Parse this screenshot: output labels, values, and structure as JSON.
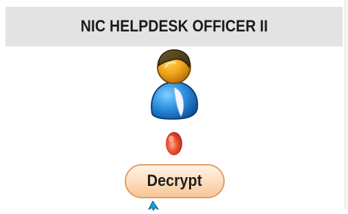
{
  "header": {
    "title": "NIC HELPDESK OFFICER II"
  },
  "avatar": {
    "icon": "user-avatar-icon"
  },
  "status": {
    "icon": "red-status-dot-icon",
    "color": "#e8412a"
  },
  "actions": {
    "decrypt_label": "Decrypt"
  },
  "cursor": {
    "icon": "arrow-cursor-icon",
    "color": "#1e9fd6"
  },
  "colors": {
    "header_bg": "#e3e3e3",
    "button_border": "#e29c5f",
    "button_fill": "#fde0c2"
  }
}
